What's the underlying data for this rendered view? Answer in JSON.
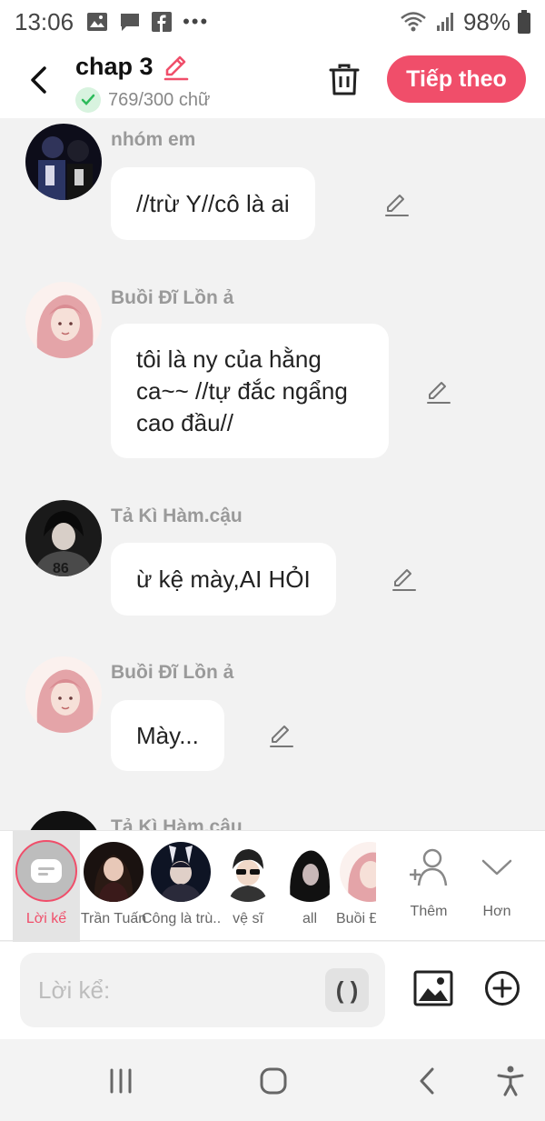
{
  "status": {
    "time": "13:06",
    "battery": "98%",
    "icons": [
      "gallery-icon",
      "message-icon",
      "facebook-icon",
      "more-dots-icon",
      "wifi-icon",
      "signal-icon",
      "battery-icon"
    ]
  },
  "header": {
    "title": "chap 3",
    "word_count": "769/300 chữ",
    "next_label": "Tiếp theo",
    "accent_color": "#f04e6a"
  },
  "messages": [
    {
      "sender": "nhóm em",
      "text": "//trừ Y//cô là ai"
    },
    {
      "sender": "Buồi Đĩ Lồn ả",
      "text": "tôi là ny của hằng ca~~ //tự đắc ngẩng cao đầu//"
    },
    {
      "sender": "Tả Kì Hàm.cậu",
      "text": "ừ kệ mày,AI HỎI"
    },
    {
      "sender": "Buồi Đĩ Lồn ả",
      "text": "Mày..."
    },
    {
      "sender": "Tả Kì Hàm.cậu",
      "text": ""
    }
  ],
  "characters": [
    {
      "label": "Lời kể"
    },
    {
      "label": "Trần Tuấn"
    },
    {
      "label": "Công là trù..."
    },
    {
      "label": "vệ sĩ"
    },
    {
      "label": "all"
    },
    {
      "label": "Buồi Đ"
    }
  ],
  "actions": {
    "add_label": "Thêm",
    "more_label": "Hơn"
  },
  "input": {
    "placeholder": "Lời kể:",
    "paren_label": "( )"
  }
}
